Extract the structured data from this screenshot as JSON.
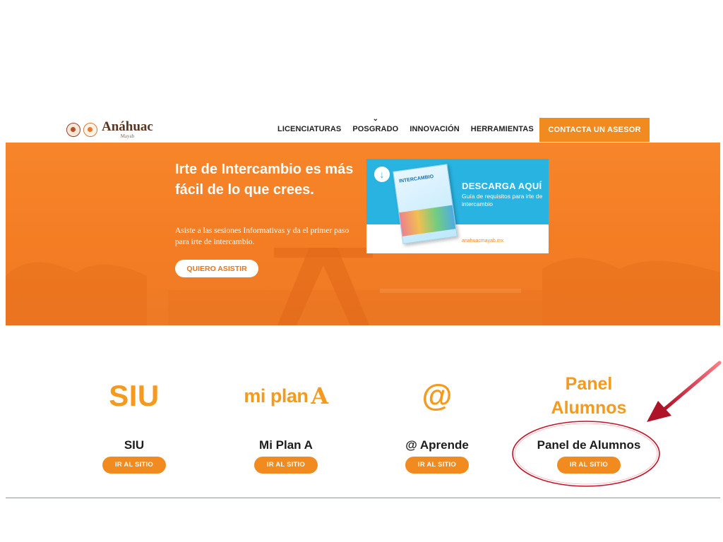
{
  "header": {
    "logo_name": "Anáhuac",
    "logo_sub": "Mayab",
    "nav": [
      {
        "label": "LICENCIATURAS"
      },
      {
        "label": "POSGRADO"
      },
      {
        "label": "INNOVACIÓN"
      },
      {
        "label": "HERRAMIENTAS"
      }
    ],
    "cta_label": "CONTACTA UN ASESOR"
  },
  "hero": {
    "title": "Irte de Intercambio es más fácil de lo que crees.",
    "description": "Asiste a las sesiones Informativas y da el primer paso para irte de intercambio.",
    "button_label": "QUIERO ASISTIR",
    "promo": {
      "book_title": "INTERCAMBIO",
      "title": "DESCARGA AQUÍ",
      "subtitle": "Guía de requisitos para irte de intercambio",
      "url": "anahuacmayab.mx"
    }
  },
  "services": [
    {
      "logo": "SIU",
      "name": "SIU",
      "button_label": "IR AL SITIO"
    },
    {
      "logo": "mi plan",
      "logo_mark": "A",
      "name": "Mi Plan A",
      "button_label": "IR AL SITIO"
    },
    {
      "logo": "@",
      "name": "@ Aprende",
      "button_label": "IR AL SITIO"
    },
    {
      "logo_line1": "Panel",
      "logo_line2": "Alumnos",
      "name": "Panel de Alumnos",
      "button_label": "IR AL SITIO"
    }
  ],
  "colors": {
    "brand_orange": "#f18a1f",
    "hero_orange": "#f47d24",
    "promo_blue": "#28b3e0",
    "annotation_red": "#c0142a"
  }
}
